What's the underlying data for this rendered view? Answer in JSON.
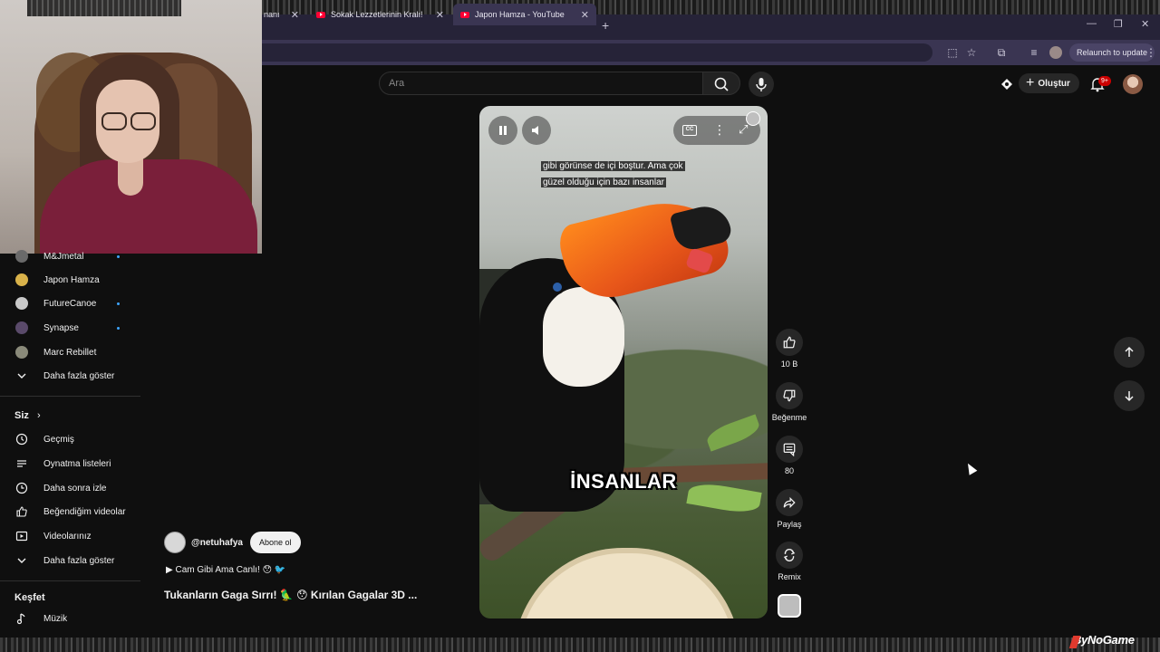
{
  "browser": {
    "tabs": [
      {
        "title": "nanında"
      },
      {
        "title": "Sokak Lezzetlerinin Kralı! baharat"
      },
      {
        "title": "Japon Hamza - YouTube"
      }
    ],
    "relaunch_label": "Relaunch to update"
  },
  "masthead": {
    "search_placeholder": "Ara",
    "create_label": "Oluştur",
    "notification_count": "9+"
  },
  "sidebar": {
    "subscriptions": [
      {
        "name": "M&Jmetal"
      },
      {
        "name": "Japon Hamza"
      },
      {
        "name": "FutureCanoe"
      },
      {
        "name": "Synapse"
      },
      {
        "name": "Marc Rebillet"
      }
    ],
    "show_more_1": "Daha fazla göster",
    "you_header": "Siz",
    "you_items": [
      {
        "label": "Geçmiş",
        "icon": "history-icon"
      },
      {
        "label": "Oynatma listeleri",
        "icon": "playlists-icon"
      },
      {
        "label": "Daha sonra izle",
        "icon": "clock-icon"
      },
      {
        "label": "Beğendiğim videolar",
        "icon": "thumbs-up-icon"
      },
      {
        "label": "Videolarınız",
        "icon": "play-box-icon"
      }
    ],
    "show_more_2": "Daha fazla göster",
    "explore_header": "Keşfet",
    "explore_items": [
      {
        "label": "Müzik",
        "icon": "music-note-icon"
      }
    ]
  },
  "player": {
    "caption_line1": "gibi görünse de içi boştur. Ama çok",
    "caption_line2": "güzel olduğu için bazı insanlar",
    "big_caption": "İNSANLAR"
  },
  "actions": {
    "like_count": "10 B",
    "dislike_label": "Beğenme",
    "comment_count": "80",
    "share_label": "Paylaş",
    "remix_label": "Remix"
  },
  "video": {
    "channel_handle": "@netuhafya",
    "subscribe_label": "Abone ol",
    "description": "▶ Cam Gibi Ama Canlı! 😯 🐦",
    "title": "Tukanların Gaga Sırrı! 🦜 😯 Kırılan Gagalar 3D ..."
  },
  "overlay": {
    "watermark": "ByNoGame"
  },
  "colors": {
    "background": "#0f0f0f",
    "browser_chrome": "#3a3552",
    "accent_blue": "#3ea6ff",
    "notification_red": "#cc0000"
  }
}
